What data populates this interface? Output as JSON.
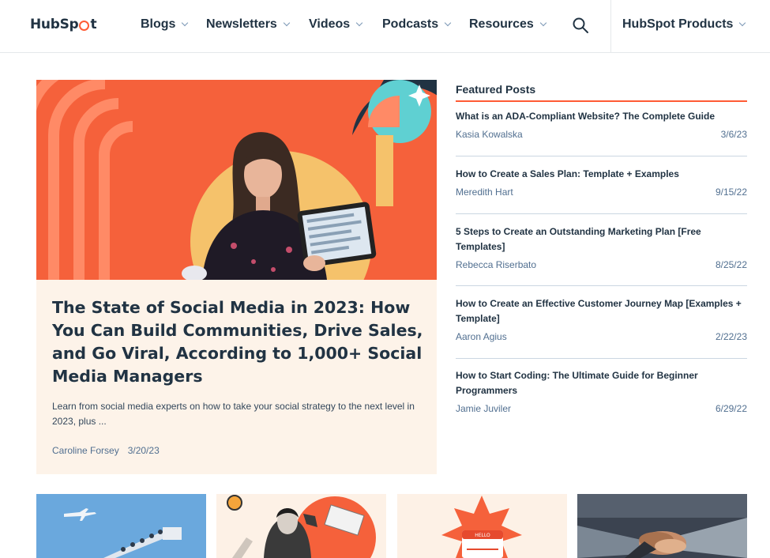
{
  "header": {
    "logo": "HubSpot",
    "nav": [
      "Blogs",
      "Newsletters",
      "Videos",
      "Podcasts",
      "Resources"
    ],
    "products": "HubSpot Products"
  },
  "hero": {
    "title": "The State of Social Media in 2023: How You Can Build Communities, Drive Sales, and Go Viral, According to 1,000+ Social Media Managers",
    "description": "Learn from social media experts on how to take your social strategy to the next level in 2023, plus ...",
    "author": "Caroline Forsey",
    "date": "3/20/23"
  },
  "featured": {
    "heading": "Featured Posts",
    "posts": [
      {
        "title": "What is an ADA-Compliant Website? The Complete Guide",
        "author": "Kasia Kowalska",
        "date": "3/6/23"
      },
      {
        "title": "How to Create a Sales Plan: Template + Examples",
        "author": "Meredith Hart",
        "date": "9/15/22"
      },
      {
        "title": "5 Steps to Create an Outstanding Marketing Plan [Free Templates]",
        "author": "Rebecca Riserbato",
        "date": "8/25/22"
      },
      {
        "title": "How to Create an Effective Customer Journey Map [Examples + Template]",
        "author": "Aaron Agius",
        "date": "2/22/23"
      },
      {
        "title": "How to Start Coding: The Ultimate Guide for Beginner Programmers",
        "author": "Jamie Juviler",
        "date": "6/29/22"
      }
    ]
  },
  "thumbnails": {
    "badge": "HELLO"
  },
  "colors": {
    "accent": "#ff5c35",
    "heading": "#213343",
    "meta": "#516f90",
    "hero_bg": "#fdf3e9"
  }
}
